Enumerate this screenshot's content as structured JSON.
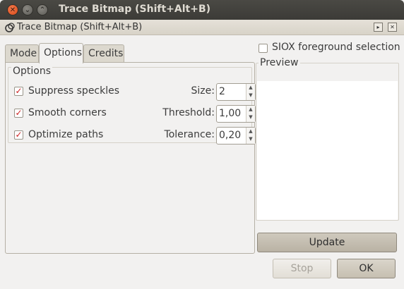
{
  "window": {
    "title": "Trace Bitmap (Shift+Alt+B)",
    "close_glyph": "✕",
    "min_glyph": "⌄",
    "max_glyph": "⌃"
  },
  "dock": {
    "title": "Trace Bitmap (Shift+Alt+B)",
    "icon": "trace-bitmap-icon",
    "btn1": "▸",
    "btn2": "✕"
  },
  "tabs": [
    {
      "label": "Mode",
      "active": false
    },
    {
      "label": "Options",
      "active": true
    },
    {
      "label": "Credits",
      "active": false
    }
  ],
  "options": {
    "frame_label": "Options",
    "rows": [
      {
        "label": "Suppress speckles",
        "checked": true,
        "param_label": "Size:",
        "value": "2"
      },
      {
        "label": "Smooth corners",
        "checked": true,
        "param_label": "Threshold:",
        "value": "1,00"
      },
      {
        "label": "Optimize paths",
        "checked": true,
        "param_label": "Tolerance:",
        "value": "0,20"
      }
    ]
  },
  "siox": {
    "label": "SIOX foreground selection",
    "checked": false
  },
  "preview": {
    "label": "Preview"
  },
  "buttons": {
    "update": "Update",
    "stop": "Stop",
    "ok": "OK"
  },
  "glyphs": {
    "check": "✓",
    "up": "▲",
    "down": "▼"
  },
  "colors": {
    "accent_close": "#e0551f",
    "checkmark": "#c22222"
  }
}
